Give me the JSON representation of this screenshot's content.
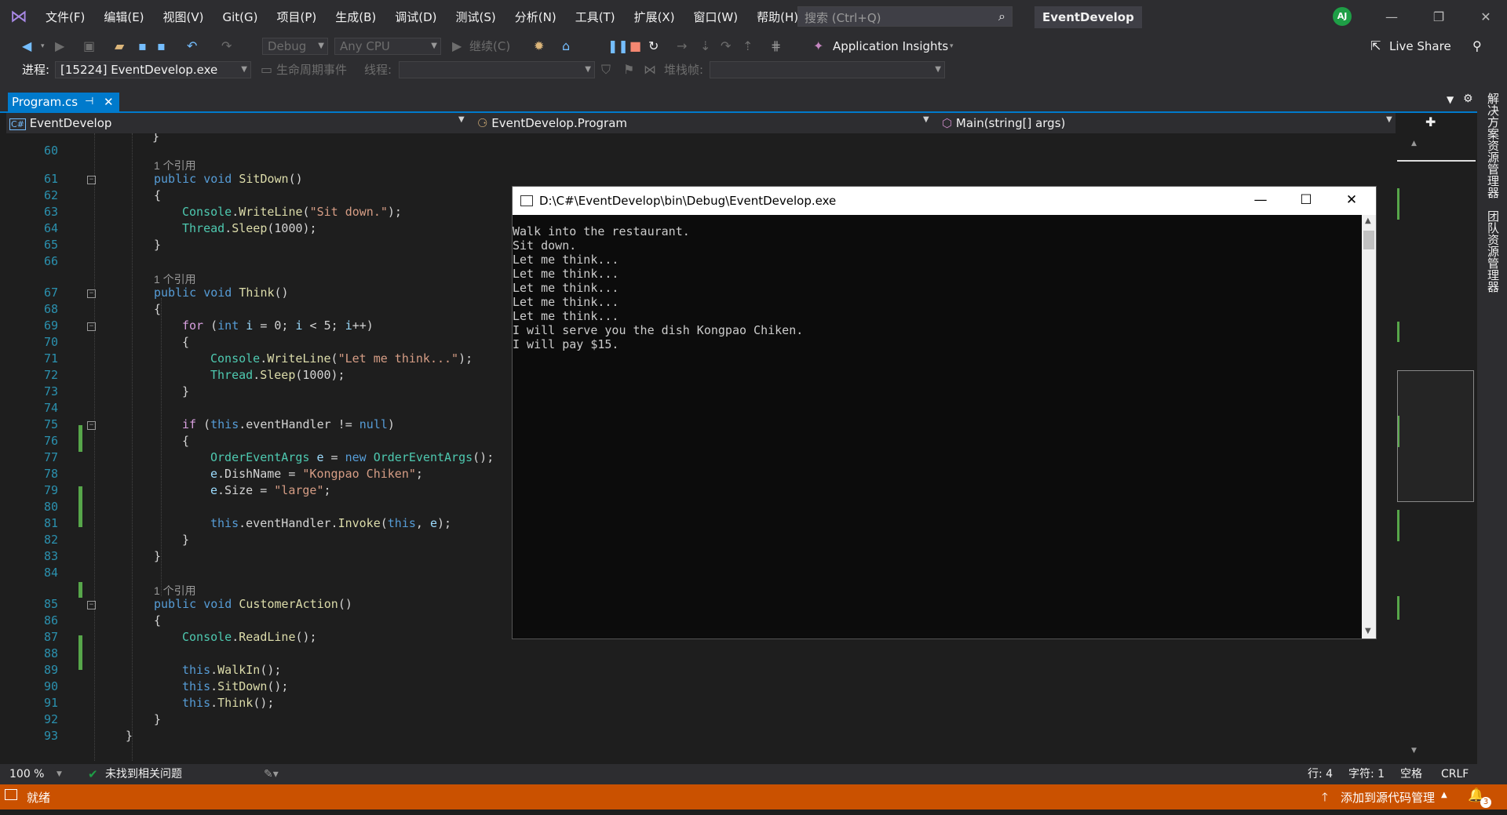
{
  "menu": [
    "文件(F)",
    "编辑(E)",
    "视图(V)",
    "Git(G)",
    "项目(P)",
    "生成(B)",
    "调试(D)",
    "测试(S)",
    "分析(N)",
    "工具(T)",
    "扩展(X)",
    "窗口(W)",
    "帮助(H)"
  ],
  "search": {
    "placeholder": "搜索 (Ctrl+Q)"
  },
  "solution_title": "EventDevelop",
  "avatar_initials": "AJ",
  "toolbar": {
    "config": "Debug",
    "platform": "Any CPU",
    "continue_label": "继续(C)",
    "app_insights": "Application Insights",
    "live_share": "Live Share",
    "process_label": "进程:",
    "process_value": "[15224] EventDevelop.exe",
    "lifecycle_label": "生命周期事件",
    "thread_label": "线程:",
    "stackframe_label": "堆栈帧:"
  },
  "tab": {
    "label": "Program.cs"
  },
  "nav": {
    "project": "EventDevelop",
    "class": "EventDevelop.Program",
    "member": "Main(string[] args)"
  },
  "code": {
    "l60": "60",
    "l61": "61",
    "l62": "62",
    "l63": "63",
    "l64": "64",
    "l65": "65",
    "l66": "66",
    "l67": "67",
    "l68": "68",
    "l69": "69",
    "l70": "70",
    "l71": "71",
    "l72": "72",
    "l73": "73",
    "l74": "74",
    "l75": "75",
    "l76": "76",
    "l77": "77",
    "l78": "78",
    "l79": "79",
    "l80": "80",
    "l81": "81",
    "l82": "82",
    "l83": "83",
    "l84": "84",
    "l85": "85",
    "l86": "86",
    "l87": "87",
    "l88": "88",
    "l89": "89",
    "l90": "90",
    "l91": "91",
    "l92": "92",
    "l93": "93",
    "refs": "1 个引用"
  },
  "console": {
    "title": "D:\\C#\\EventDevelop\\bin\\Debug\\EventDevelop.exe",
    "lines": [
      "Walk into the restaurant.",
      "Sit down.",
      "Let me think...",
      "Let me think...",
      "Let me think...",
      "Let me think...",
      "Let me think...",
      "I will serve you the dish Kongpao Chiken.",
      "I will pay $15."
    ]
  },
  "editor_status": {
    "zoom": "100 %",
    "issues": "未找到相关问题",
    "line": "行: 4",
    "col": "字符: 1",
    "indent": "空格",
    "eol": "CRLF"
  },
  "statusbar": {
    "ready": "就绪",
    "source_control": "添加到源代码管理",
    "notifications": "3"
  },
  "right_panel": [
    "解决方案资源管理器",
    "团队资源管理器"
  ],
  "colors": {
    "accent": "#007acc",
    "statusbar": "#ca5100",
    "background": "#1e1e1e"
  }
}
